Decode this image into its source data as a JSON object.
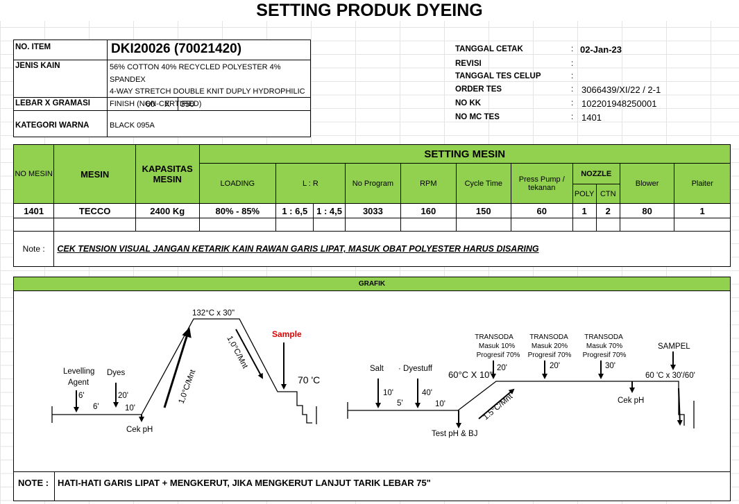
{
  "title": "SETTING PRODUK DYEING",
  "item": {
    "no_item_label": "NO. ITEM",
    "no_item_value": "DKI20026 (70021420)",
    "jenis_kain_label": "JENIS KAIN",
    "jenis_kain_lines": [
      "56% COTTON 40% RECYCLED POLYESTER 4% SPANDEX",
      "4-WAY STRETCH DOUBLE KNIT DUPLY HYDROPHILIC",
      "FINISH (NON-CERTIFIED)"
    ],
    "lebar_label": "LEBAR X GRAMASI",
    "lebar_value": "60",
    "lebar_x": "X",
    "gramasi_value": "350",
    "kategori_label": "KATEGORI WARNA",
    "kategori_value": "BLACK 095A"
  },
  "info": [
    {
      "label": "TANGGAL CETAK",
      "sep": ":",
      "value": "02-Jan-23"
    },
    {
      "label": "REVISI",
      "sep": ":",
      "value": ""
    },
    {
      "label": "TANGGAL TES CELUP",
      "sep": ":",
      "value": ""
    },
    {
      "label": "ORDER TES",
      "sep": ":",
      "value": "3066439/XI/22 / 2-1"
    },
    {
      "label": "NO KK",
      "sep": ":",
      "value": "102201948250001"
    },
    {
      "label": "NO MC TES",
      "sep": ":",
      "value": "1401"
    }
  ],
  "setting": {
    "header": "SETTING MESIN",
    "cols": {
      "no_mesin": "NO MESIN",
      "mesin": "MESIN",
      "kapasitas_l1": "KAPASITAS",
      "kapasitas_l2": "MESIN",
      "loading": "LOADING",
      "lr": "L : R",
      "no_program": "No Program",
      "rpm": "RPM",
      "cycle_time": "Cycle Time",
      "press_l1": "Press Pump /",
      "press_l2": "tekanan",
      "nozzle": "NOZZLE",
      "poly": "POLY",
      "ctn": "CTN",
      "blower": "Blower",
      "plaiter": "Plaiter"
    },
    "row": {
      "no_mesin": "1401",
      "mesin": "TECCO",
      "kapasitas": "2400 Kg",
      "loading": "80% - 85%",
      "lr1": "1 : 6,5",
      "lr2": "1 : 4,5",
      "no_program": "3033",
      "rpm": "160",
      "cycle_time": "150",
      "press": "60",
      "poly": "1",
      "ctn": "2",
      "blower": "80",
      "plaiter": "1"
    },
    "note_label": "Note :",
    "note_text": "CEK TENSION VISUAL JANGAN KETARIK KAIN RAWAN GARIS LIPAT, MASUK OBAT POLYESTER HARUS DISARING"
  },
  "grafik": {
    "header": "GRAFIK",
    "left": {
      "peak": "132°C x 30\"",
      "rise": "1,0°C/Mnt",
      "fall": "1,0°C/Mnt",
      "sample": "Sample",
      "end_temp": "70 'C",
      "levelling_l1": "Levelling",
      "levelling_l2": "Agent",
      "dyes": "Dyes",
      "t6a": "6'",
      "t6b": "6'",
      "t20": "20'",
      "t10": "10'",
      "cek_ph": "Cek pH"
    },
    "right": {
      "salt": "Salt",
      "dyestuff": "· Dyestuff",
      "t10a": "10'",
      "t5": "5'",
      "t40": "40'",
      "t10b": "10'",
      "test_ph": "Test pH & BJ",
      "hold": "60°C X 10\"",
      "rise": "1.5°C/Mnt",
      "tr1": [
        "TRANSODA",
        "Masuk 10%",
        "Progresif 70%"
      ],
      "tr2": [
        "TRANSODA",
        "Masuk 20%",
        "Progresif 70%"
      ],
      "tr3": [
        "TRANSODA",
        "Masuk 70%",
        "Progresif 70%"
      ],
      "t20a": "20'",
      "t20b": "20'",
      "t30": "30'",
      "cek_ph": "Cek pH",
      "sampel": "SAMPEL",
      "end": "60 'C x 30'/60'"
    }
  },
  "bottom_note": {
    "label": "NOTE :",
    "text": "HATI-HATI GARIS LIPAT + MENGKERUT, JIKA MENGKERUT LANJUT TARIK LEBAR 75\""
  },
  "colors": {
    "header_green": "#92d050",
    "sample_red": "#e00000"
  }
}
